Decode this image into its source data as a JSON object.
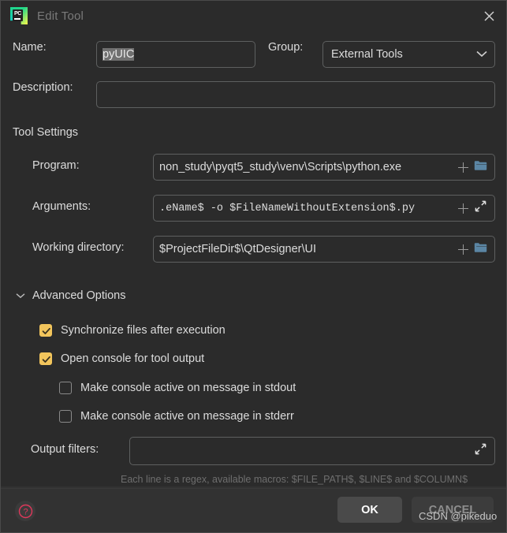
{
  "window": {
    "title": "Edit Tool",
    "app_icon": "pycharm-icon",
    "app_icon_text": "PC",
    "close_icon": "close-icon"
  },
  "form": {
    "name_label": "Name:",
    "name_value": "pyUIC",
    "group_label": "Group:",
    "group_value": "External Tools",
    "group_options": [
      "External Tools"
    ],
    "description_label": "Description:",
    "description_value": "",
    "description_placeholder": ""
  },
  "tool_settings": {
    "heading": "Tool Settings",
    "program_label": "Program:",
    "program_value": "non_study\\pyqt5_study\\venv\\Scripts\\python.exe",
    "arguments_label": "Arguments:",
    "arguments_value": ".eName$ -o $FileNameWithoutExtension$.py",
    "working_directory_label": "Working directory:",
    "working_directory_value": "$ProjectFileDir$\\QtDesigner\\UI",
    "insert_macro_icon": "plus-icon",
    "browse_icon": "folder-icon",
    "expand_icon": "expand-arrows-icon"
  },
  "advanced": {
    "toggle_label": "Advanced Options",
    "toggle_icon": "chevron-down-icon",
    "expanded": true,
    "checkboxes": [
      {
        "label": "Synchronize files after execution",
        "checked": true,
        "indent": 0
      },
      {
        "label": "Open console for tool output",
        "checked": true,
        "indent": 0
      },
      {
        "label": "Make console active on message in stdout",
        "checked": false,
        "indent": 1
      },
      {
        "label": "Make console active on message in stderr",
        "checked": false,
        "indent": 1
      }
    ],
    "output_filters_label": "Output filters:",
    "output_filters_value": "",
    "output_filters_hint": "Each line is a regex, available macros: $FILE_PATH$, $LINE$ and $COLUMN$"
  },
  "footer": {
    "help_icon": "help-question-icon",
    "ok_label": "OK",
    "cancel_label": "CANCEL"
  },
  "watermark": {
    "text": "CSDN @pikeduo"
  },
  "colors": {
    "background": "#2b2b2b",
    "footer_background": "#323232",
    "border": "#5e6060",
    "text": "#dcdcdc",
    "muted_text": "#6e6e6e",
    "checkbox_on": "#f2c55c",
    "icon_blue": "#5b86a4",
    "help_red": "#e0385b",
    "selection": "#707070"
  }
}
